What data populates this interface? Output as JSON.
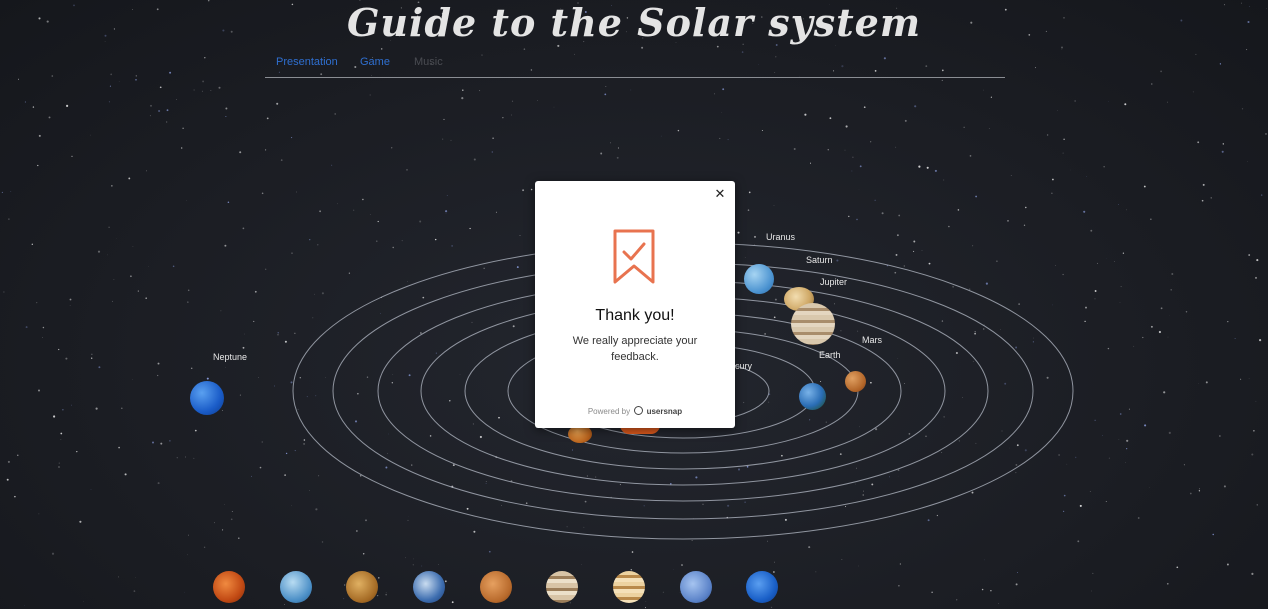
{
  "site": {
    "title": "Guide to the Solar system"
  },
  "nav": {
    "items": [
      {
        "label": "Presentation",
        "active": true
      },
      {
        "label": "Game",
        "active": true
      },
      {
        "label": "Music",
        "active": false
      }
    ]
  },
  "diagram": {
    "planet_labels": [
      "Neptune",
      "Uranus",
      "Saturn",
      "Jupiter",
      "Mars",
      "Earth",
      "cury"
    ]
  },
  "modal": {
    "close_icon": "close-icon",
    "icon": "bookmark-check-icon",
    "heading": "Thank you!",
    "message": "We really appreciate your feedback.",
    "powered_by": "Powered by",
    "brand": "usersnap",
    "accent_color": "#e8734f"
  },
  "bottom_planets": [
    "Venus",
    "Mercury",
    "Mars",
    "Earth",
    "Mars",
    "Jupiter",
    "Saturn",
    "Uranus",
    "Neptune"
  ]
}
